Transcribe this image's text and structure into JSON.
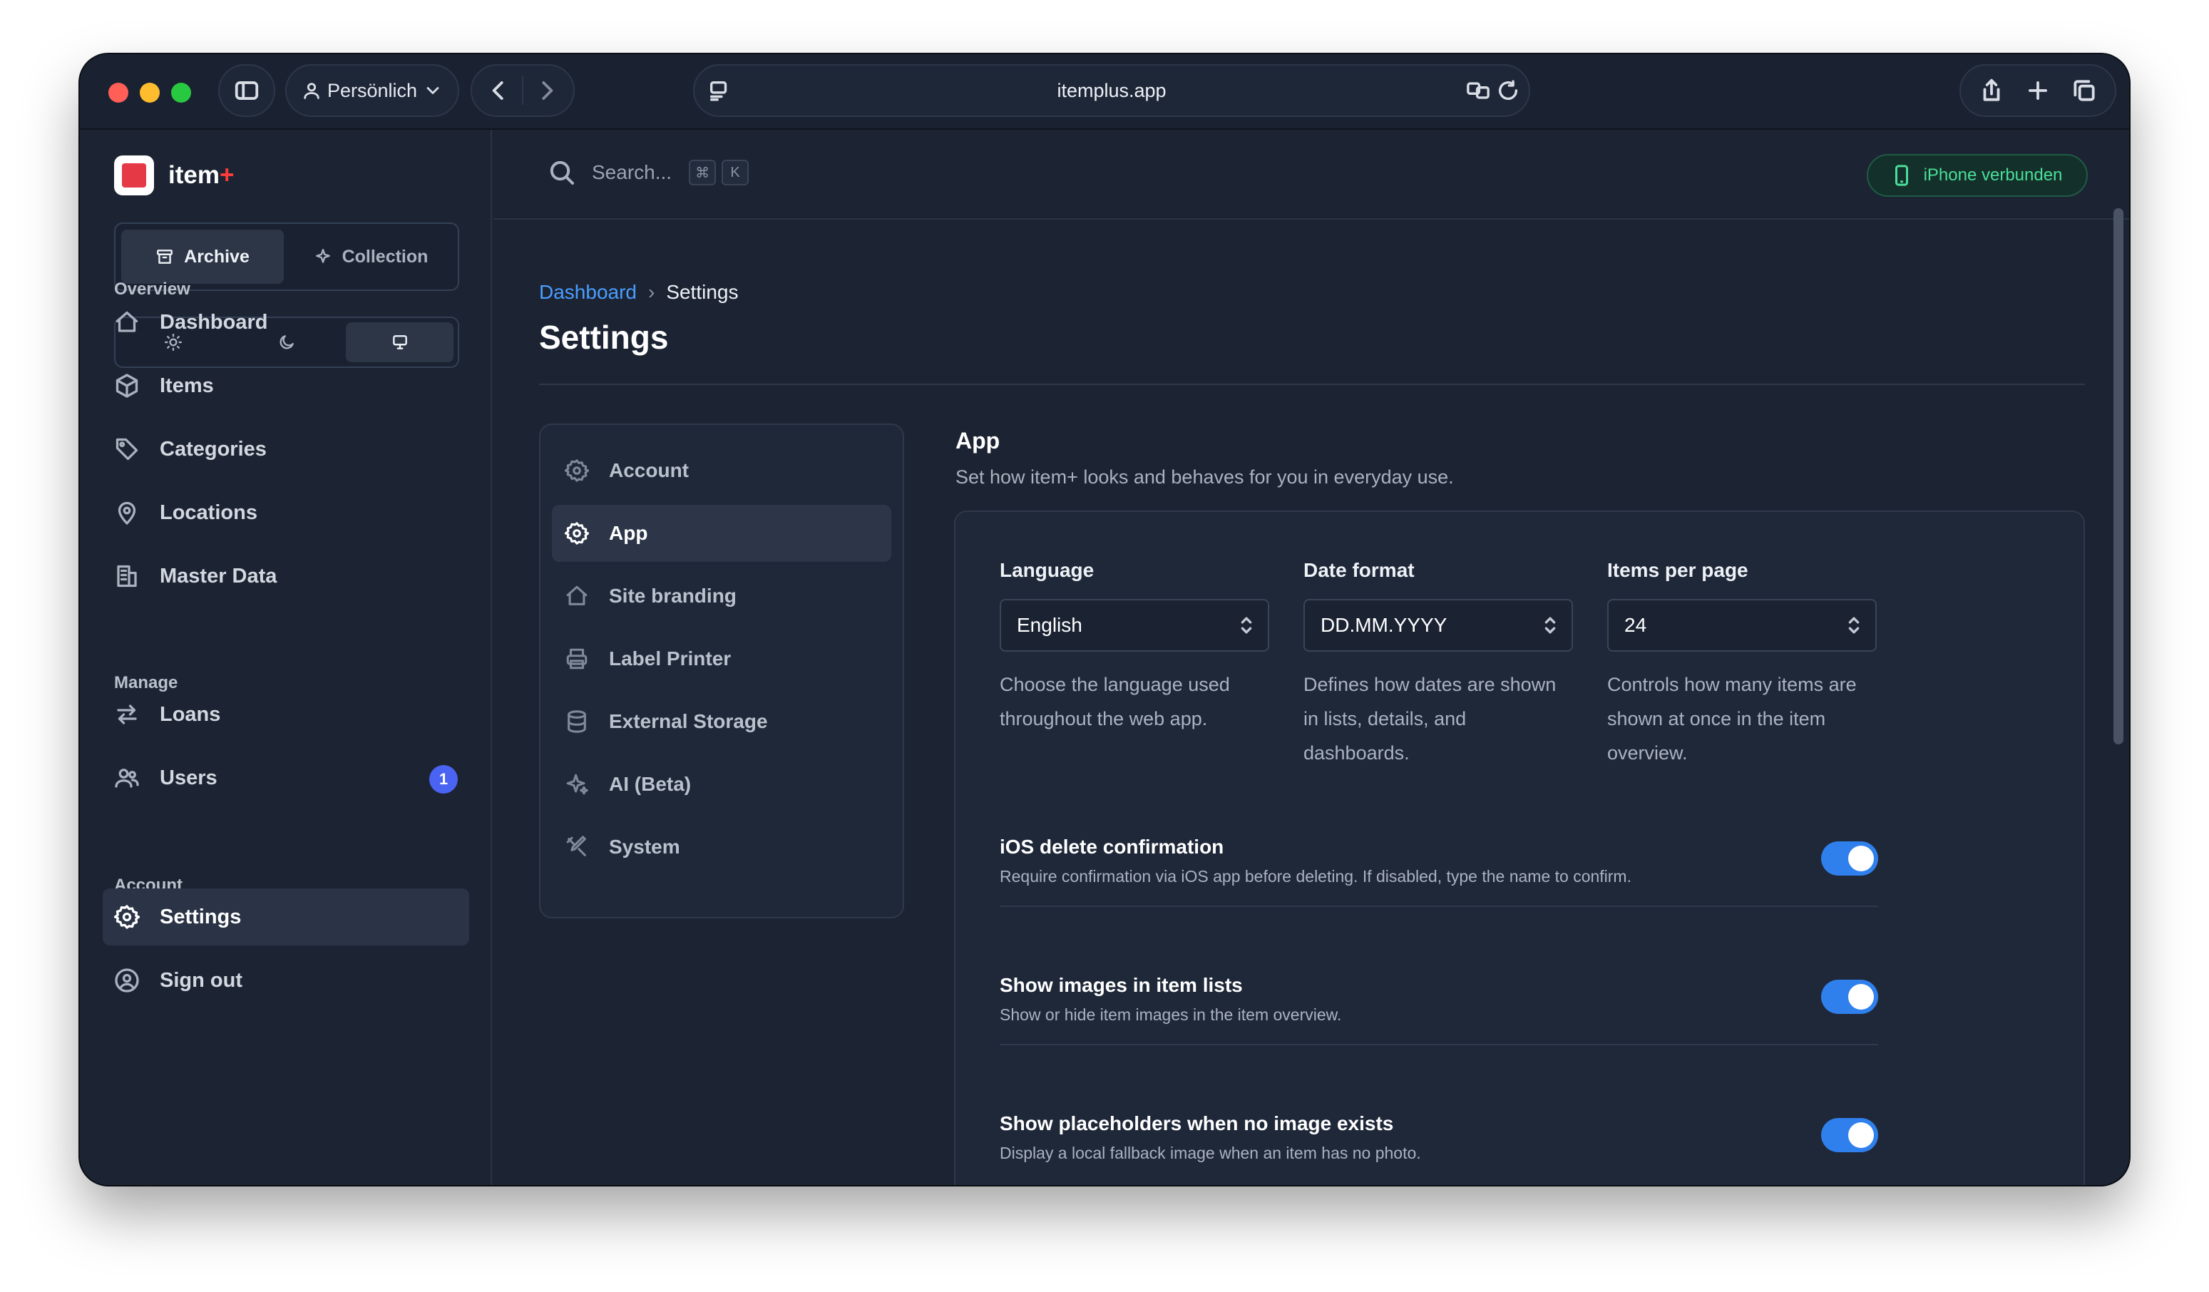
{
  "browser": {
    "profile_label": "Persönlich",
    "url": "itemplus.app"
  },
  "app": {
    "name": "item",
    "name_suffix": "+"
  },
  "mode_switch": {
    "archive_label": "Archive",
    "collection_label": "Collection"
  },
  "sidebar": {
    "overview_label": "Overview",
    "overview_items": [
      {
        "label": "Dashboard",
        "icon": "home-icon"
      },
      {
        "label": "Items",
        "icon": "cube-icon"
      },
      {
        "label": "Categories",
        "icon": "tag-icon"
      },
      {
        "label": "Locations",
        "icon": "map-pin-icon"
      },
      {
        "label": "Master Data",
        "icon": "building-icon"
      }
    ],
    "manage_label": "Manage",
    "manage_items": [
      {
        "label": "Loans",
        "icon": "arrows-icon"
      },
      {
        "label": "Users",
        "icon": "users-icon",
        "badge": "1"
      }
    ],
    "account_label": "Account",
    "account_items": [
      {
        "label": "Settings",
        "icon": "gear-icon"
      },
      {
        "label": "Sign out",
        "icon": "user-circle-icon"
      }
    ]
  },
  "topbar": {
    "search_placeholder": "Search...",
    "shortcut_key1": "⌘",
    "shortcut_key2": "K",
    "device_status": "iPhone verbunden"
  },
  "breadcrumb": {
    "parent": "Dashboard",
    "current": "Settings"
  },
  "page_title": "Settings",
  "settings_nav": [
    {
      "label": "Account",
      "icon": "gear-icon"
    },
    {
      "label": "App",
      "icon": "gear-icon"
    },
    {
      "label": "Site branding",
      "icon": "home-icon"
    },
    {
      "label": "Label Printer",
      "icon": "printer-icon"
    },
    {
      "label": "External Storage",
      "icon": "database-icon"
    },
    {
      "label": "AI (Beta)",
      "icon": "sparkles-icon"
    },
    {
      "label": "System",
      "icon": "tools-icon"
    }
  ],
  "section": {
    "title": "App",
    "description": "Set how item+ looks and behaves for you in everyday use."
  },
  "fields": {
    "language": {
      "label": "Language",
      "value": "English",
      "help": "Choose the language used throughout the web app."
    },
    "date_format": {
      "label": "Date format",
      "value": "DD.MM.YYYY",
      "help": "Defines how dates are shown in lists, details, and dashboards."
    },
    "items_per_page": {
      "label": "Items per page",
      "value": "24",
      "help": "Controls how many items are shown at once in the item overview."
    }
  },
  "toggles": [
    {
      "title": "iOS delete confirmation",
      "desc": "Require confirmation via iOS app before deleting. If disabled, type the name to confirm.",
      "on": true
    },
    {
      "title": "Show images in item lists",
      "desc": "Show or hide item images in the item overview.",
      "on": true
    },
    {
      "title": "Show placeholders when no image exists",
      "desc": "Display a local fallback image when an item has no photo.",
      "on": true
    }
  ],
  "colors": {
    "accent": "#2f80ed",
    "link": "#4a9eff",
    "success": "#4ade9a",
    "badge": "#4b63f3"
  }
}
